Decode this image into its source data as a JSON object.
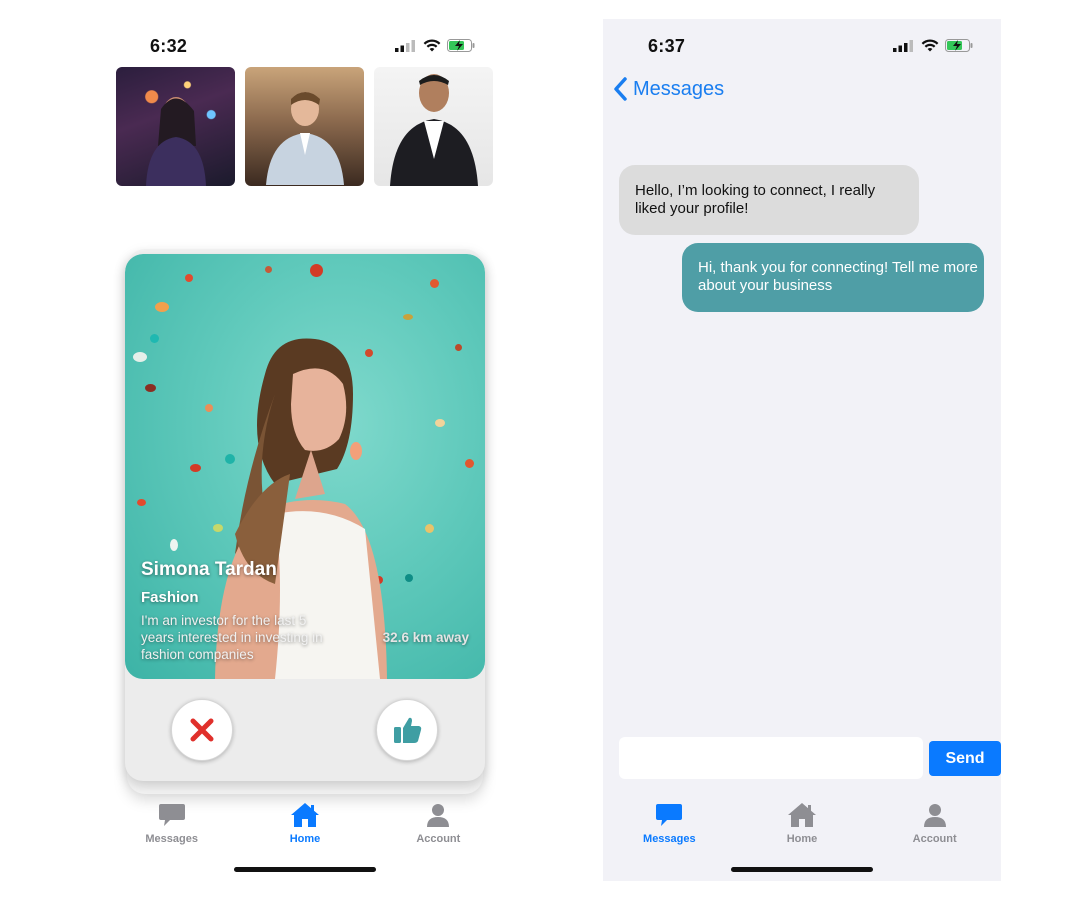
{
  "left_screen": {
    "status": {
      "time": "6:32"
    },
    "card": {
      "name": "Simona Tardan",
      "category": "Fashion",
      "bio": "I'm an investor for the last 5 years interested in investing in fashion companies",
      "distance": "32.6 km away"
    },
    "tabbar": [
      {
        "label": "Messages",
        "icon": "chat-bubble-icon",
        "active": false
      },
      {
        "label": "Home",
        "icon": "home-icon",
        "active": true
      },
      {
        "label": "Account",
        "icon": "person-icon",
        "active": false
      }
    ]
  },
  "right_screen": {
    "status": {
      "time": "6:37"
    },
    "nav": {
      "back_label": "Messages"
    },
    "messages": [
      {
        "direction": "incoming",
        "text": "Hello, I’m looking to connect, I really liked your profile!"
      },
      {
        "direction": "outgoing",
        "text": "Hi, thank you for connecting! Tell me more about your business"
      }
    ],
    "composer": {
      "value": "",
      "send_label": "Send"
    },
    "tabbar": [
      {
        "label": "Messages",
        "icon": "chat-bubble-icon",
        "active": true
      },
      {
        "label": "Home",
        "icon": "home-icon",
        "active": false
      },
      {
        "label": "Account",
        "icon": "person-icon",
        "active": false
      }
    ]
  },
  "colors": {
    "accent": "#0a7aff",
    "outgoing_bubble": "#4f9ea6",
    "incoming_bubble": "#dcdcdc",
    "reject": "#e0302b",
    "like": "#3f9ea3"
  }
}
